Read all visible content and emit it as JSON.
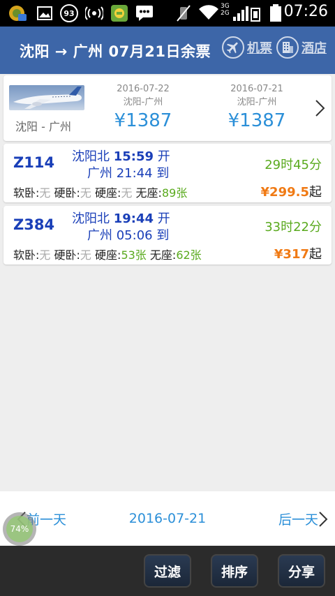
{
  "status_bar": {
    "battery_badge": "93",
    "network_labels": [
      "3G",
      "2G"
    ],
    "time": "07:26"
  },
  "header": {
    "title": "沈阳 → 广州 07月21日余票",
    "flight_label": "机票",
    "hotel_label": "酒店"
  },
  "ad": {
    "route": "沈阳 - 广州",
    "offers": [
      {
        "date": "2016-07-22",
        "route": "沈阳-广州",
        "price": "¥1387"
      },
      {
        "date": "2016-07-21",
        "route": "沈阳-广州",
        "price": "¥1387"
      }
    ]
  },
  "trains": [
    {
      "number": "Z114",
      "from_station": "沈阳北",
      "depart_time": "15:59",
      "depart_suffix": "开",
      "to_station": "广州",
      "arrive_time": "21:44",
      "arrive_suffix": "到",
      "duration": "29时45分",
      "seats": [
        {
          "label": "软卧:",
          "value": "无",
          "available": false
        },
        {
          "label": "硬卧:",
          "value": "无",
          "available": false
        },
        {
          "label": "硬座:",
          "value": "无",
          "available": false
        },
        {
          "label": "无座:",
          "value": "89张",
          "available": true
        }
      ],
      "price": "¥299.5",
      "price_suffix": "起"
    },
    {
      "number": "Z384",
      "from_station": "沈阳北",
      "depart_time": "19:44",
      "depart_suffix": "开",
      "to_station": "广州",
      "arrive_time": "05:06",
      "arrive_suffix": "到",
      "duration": "33时22分",
      "seats": [
        {
          "label": "软卧:",
          "value": "无",
          "available": false
        },
        {
          "label": "硬卧:",
          "value": "无",
          "available": false
        },
        {
          "label": "硬座:",
          "value": "53张",
          "available": true
        },
        {
          "label": "无座:",
          "value": "62张",
          "available": true
        }
      ],
      "price": "¥317",
      "price_suffix": "起"
    }
  ],
  "date_nav": {
    "prev_label": "前一天",
    "current_date": "2016-07-21",
    "next_label": "后一天"
  },
  "float_ball": {
    "percent": "74%"
  },
  "toolbar": {
    "filter_label": "过滤",
    "sort_label": "排序",
    "share_label": "分享"
  },
  "colors": {
    "header_bg": "#3d66a8",
    "train_number": "#1a3fb8",
    "available_green": "#5aaa1e",
    "price_orange": "#f07a14",
    "link_blue": "#2b8fd8"
  }
}
